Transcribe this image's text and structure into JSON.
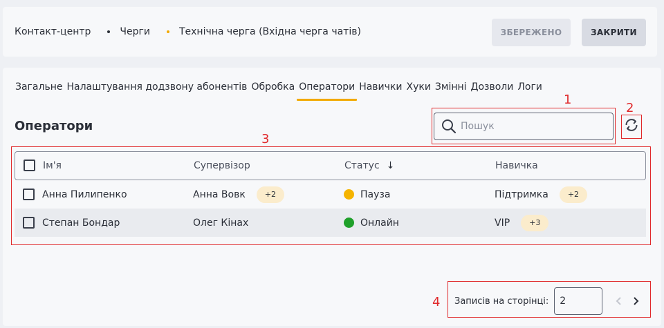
{
  "header": {
    "breadcrumb": [
      "Контакт-центр",
      "Черги",
      "Технічна черга (Вхідна черга чатів)"
    ],
    "breadcrumb_dot_colors": [
      "#2b2f38",
      "#f2a900"
    ],
    "saved_label": "ЗБЕРЕЖЕНО",
    "close_label": "ЗАКРИТИ"
  },
  "tabs": [
    {
      "label": "Загальне",
      "active": false
    },
    {
      "label": "Налаштування додзвону абонентів",
      "active": false
    },
    {
      "label": "Обробка",
      "active": false
    },
    {
      "label": "Оператори",
      "active": true
    },
    {
      "label": "Навички",
      "active": false
    },
    {
      "label": "Хуки",
      "active": false
    },
    {
      "label": "Змінні",
      "active": false
    },
    {
      "label": "Дозволи",
      "active": false
    },
    {
      "label": "Логи",
      "active": false
    }
  ],
  "section_title": "Оператори",
  "search": {
    "placeholder": "Пошук",
    "value": "",
    "icon": "search-icon"
  },
  "refresh_icon": "refresh-icon",
  "table": {
    "columns": [
      "Ім'я",
      "Супервізор",
      "Статус",
      "Навичка"
    ],
    "sort_column": "Статус",
    "sort_icon": "arrow-down-icon",
    "rows": [
      {
        "name": "Анна Пилипенко",
        "supervisor": "Анна Вовк",
        "supervisor_extra": "+2",
        "status": "Пауза",
        "status_color": "#f5b400",
        "skill": "Підтримка",
        "skill_extra": "+2"
      },
      {
        "name": "Степан Бондар",
        "supervisor": "Олег Кінах",
        "supervisor_extra": "",
        "status": "Онлайн",
        "status_color": "#1fa02a",
        "skill": "VIP",
        "skill_extra": "+3"
      }
    ]
  },
  "pagination": {
    "label": "Записів на сторінці:",
    "page_size": "2"
  },
  "annotations": [
    "1",
    "2",
    "3",
    "4"
  ],
  "colors": {
    "accent": "#f2a900",
    "annotation": "#e0292b"
  }
}
